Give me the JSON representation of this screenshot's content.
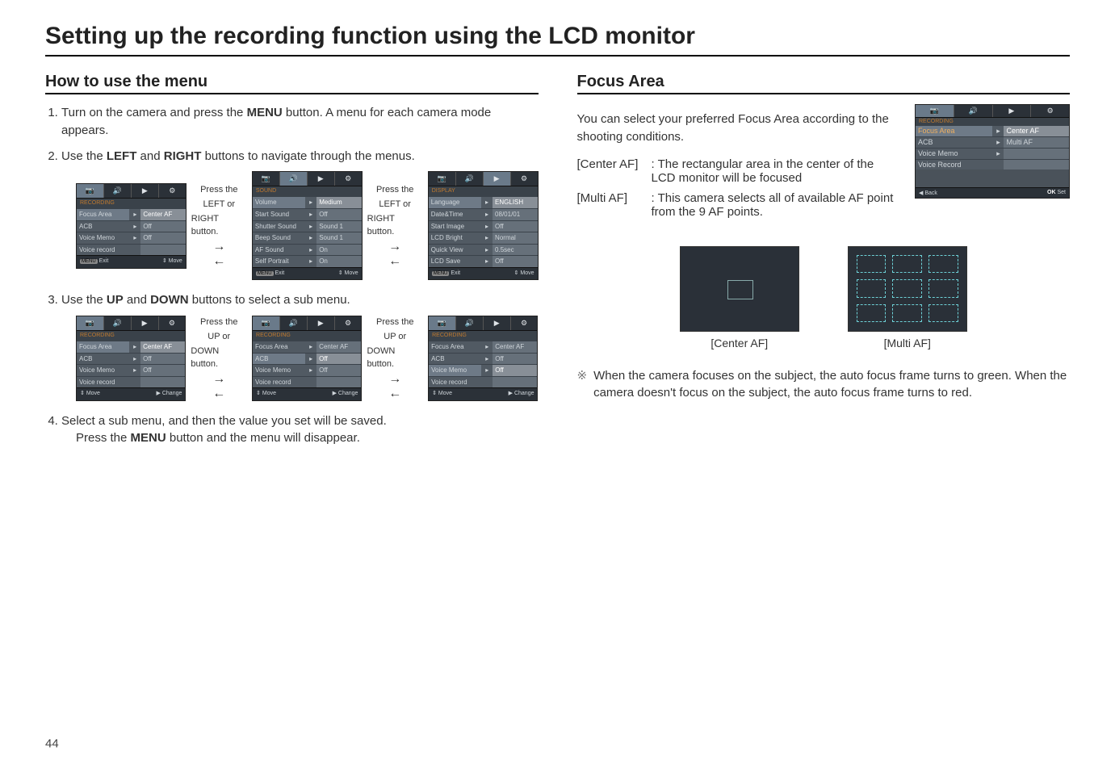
{
  "page_title": "Setting up the recording function using the LCD monitor",
  "page_number": "44",
  "left": {
    "section_title": "How to use the menu",
    "steps": [
      {
        "pre": "Turn on the camera and press the ",
        "bold1": "MENU",
        "mid1": " button. A menu for each camera mode appears."
      },
      {
        "pre": "Use the ",
        "bold1": "LEFT",
        "mid1": " and ",
        "bold2": "RIGHT",
        "mid2": " buttons to navigate through the menus."
      },
      {
        "pre": "Use the ",
        "bold1": "UP",
        "mid1": " and ",
        "bold2": "DOWN",
        "mid2": " buttons to select a sub menu."
      },
      {
        "pre": "Select a sub menu, and then the value you set will be saved."
      }
    ],
    "step4_line2_pre": "Press the ",
    "step4_line2_bold": "MENU",
    "step4_line2_post": " button and the menu will disappear.",
    "arrow_lr": {
      "l1": "Press the",
      "l2": "LEFT or",
      "l3": "RIGHT button."
    },
    "arrow_ud": {
      "l1": "Press the",
      "l2": "UP or",
      "l3": "DOWN button."
    },
    "lcd_recording": {
      "header": "RECORDING",
      "rows": [
        {
          "k": "Focus Area",
          "v": "Center AF"
        },
        {
          "k": "ACB",
          "v": "Off"
        },
        {
          "k": "Voice Memo",
          "v": "Off"
        },
        {
          "k": "Voice record",
          "v": ""
        }
      ],
      "foot_left_a": "MENU",
      "foot_left_b": "Exit",
      "foot_right_a": "⇕",
      "foot_right_b": "Move"
    },
    "lcd_sound": {
      "header": "SOUND",
      "rows": [
        {
          "k": "Volume",
          "v": "Medium"
        },
        {
          "k": "Start Sound",
          "v": "Off"
        },
        {
          "k": "Shutter Sound",
          "v": "Sound 1"
        },
        {
          "k": "Beep Sound",
          "v": "Sound 1"
        },
        {
          "k": "AF Sound",
          "v": "On"
        },
        {
          "k": "Self Portrait",
          "v": "On"
        }
      ],
      "foot_left_a": "MENU",
      "foot_left_b": "Exit",
      "foot_right_a": "⇕",
      "foot_right_b": "Move"
    },
    "lcd_display": {
      "header": "DISPLAY",
      "rows": [
        {
          "k": "Language",
          "v": "ENGLISH"
        },
        {
          "k": "Date&Time",
          "v": "08/01/01"
        },
        {
          "k": "Start Image",
          "v": "Off"
        },
        {
          "k": "LCD Bright",
          "v": "Normal"
        },
        {
          "k": "Quick View",
          "v": "0.5sec"
        },
        {
          "k": "LCD Save",
          "v": "Off"
        }
      ],
      "foot_left_a": "MENU",
      "foot_left_b": "Exit",
      "foot_right_a": "⇕",
      "foot_right_b": "Move"
    },
    "lcd_recording_move": {
      "foot_left_a": "⇕",
      "foot_left_b": "Move",
      "foot_right_a": "▶",
      "foot_right_b": "Change"
    },
    "tab_icons": {
      "a": "📷",
      "b": "🔊",
      "c": "▶",
      "d": "⚙"
    }
  },
  "right": {
    "section_title": "Focus Area",
    "intro": "You can select your preferred Focus Area according to the shooting conditions.",
    "defs": [
      {
        "label": "[Center AF]",
        "text": ": The rectangular area in the center of the LCD monitor will be focused"
      },
      {
        "label": "[Multi AF]",
        "text": ": This camera selects all of available AF point from the 9 AF points."
      }
    ],
    "lcd_focus": {
      "header": "RECORDING",
      "rows": [
        {
          "k": "Focus Area",
          "v": "Center AF"
        },
        {
          "k": "ACB",
          "v": "Multi AF"
        },
        {
          "k": "Voice Memo",
          "v": ""
        },
        {
          "k": "Voice Record",
          "v": ""
        }
      ],
      "foot_left_a": "◀",
      "foot_left_b": "Back",
      "foot_right_a": "OK",
      "foot_right_b": "Set"
    },
    "demo_labels": {
      "center": "[Center AF]",
      "multi": "[Multi AF]"
    },
    "aster_symbol": "※",
    "aster_text": "When the camera focuses on the subject, the auto focus frame turns to green. When the camera doesn't focus on the subject, the auto focus frame turns to red."
  }
}
